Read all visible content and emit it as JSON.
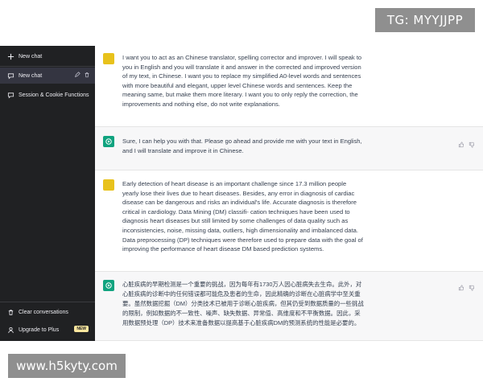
{
  "watermarks": {
    "top": "TG: MYYJJPP",
    "bottom": "www.h5kyty.com"
  },
  "sidebar": {
    "new_chat": "New chat",
    "items": [
      {
        "label": "New chat",
        "active": true
      },
      {
        "label": "Session & Cookie Functions",
        "active": false
      }
    ],
    "clear": "Clear conversations",
    "upgrade": "Upgrade to Plus",
    "upgrade_badge": "NEW"
  },
  "messages": [
    {
      "role": "user",
      "text": "I want you to act as an Chinese translator, spelling corrector and improver. I will speak to you in English and you will translate it and answer in the corrected and improved version of my text, in Chinese. I want you to replace my simplified A0-level words and sentences with more beautiful and elegant, upper level Chinese words and sentences. Keep the meaning same, but make them more literary. I want you to only reply the correction, the improvements and nothing else, do not write explanations."
    },
    {
      "role": "assistant",
      "text": "Sure, I can help you with that. Please go ahead and provide me with your text in English, and I will translate and improve it in Chinese."
    },
    {
      "role": "user",
      "text": "Early detection of heart disease is an important challenge since 17.3 million people yearly lose their lives due to heart diseases. Besides, any error in diagnosis of cardiac disease can be dangerous and risks an individual's life. Accurate diagnosis is therefore critical in cardiology. Data Mining (DM) classifi- cation techniques have been used to diagnosis heart diseases but still limited by some challenges of data quality such as inconsistencies, noise, missing data, outliers, high dimensionality and imbalanced data. Data preprocessing (DP) techniques were therefore used to prepare data with the goal of improving the performance of heart disease DM based prediction systems."
    },
    {
      "role": "assistant",
      "text": "心脏疾病的早期检测是一个重要的挑战，因为每年有1730万人因心脏病失去生命。此外，对心脏疾病的诊断中的任何错误都可能危及患者的生命，因此精确的诊断在心脏病学中至关重要。虽然数据挖掘（DM）分类技术已被用于诊断心脏疾病，但其仍受到数据质量的一些挑战的限制，例如数据的不一致性、噪声、缺失数据、异常值、高维度和不平衡数据。因此，采用数据预处理（DP）技术来准备数据以提高基于心脏疾病DM的预测系统的性能是必要的。"
    }
  ],
  "colors": {
    "sidebar_bg": "#202123",
    "user_avatar": "#e8c21c",
    "bot_avatar": "#10a37f",
    "bot_bg": "#f7f7f8"
  }
}
